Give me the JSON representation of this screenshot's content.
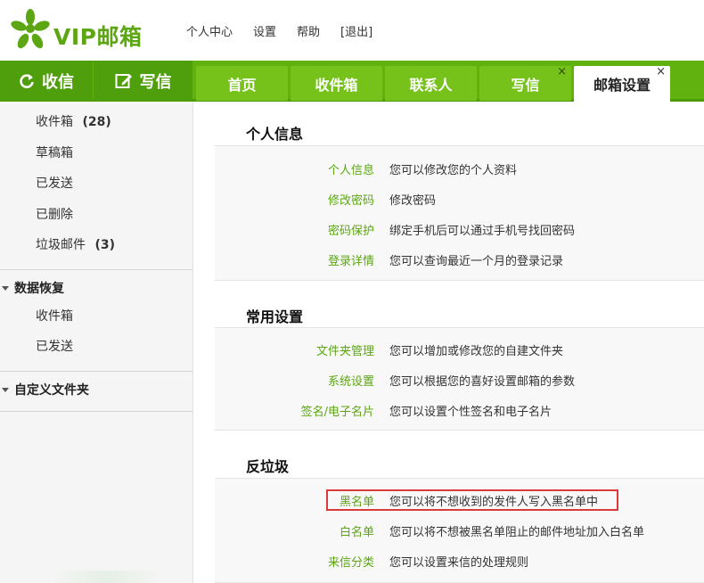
{
  "header": {
    "logo_text": "VIP邮箱",
    "nav": [
      "个人中心",
      "设置",
      "帮助",
      "[退出]"
    ]
  },
  "actions": {
    "receive_label": "收信",
    "write_label": "写信"
  },
  "tabs": [
    {
      "label": "首页"
    },
    {
      "label": "收件箱"
    },
    {
      "label": "联系人"
    },
    {
      "label": "写信",
      "close": "×"
    },
    {
      "label": "邮箱设置",
      "close": "×"
    }
  ],
  "sidebar": {
    "folders": [
      {
        "label": "收件箱",
        "count": "(28)"
      },
      {
        "label": "草稿箱"
      },
      {
        "label": "已发送"
      },
      {
        "label": "已删除"
      },
      {
        "label": "垃圾邮件",
        "count": "(3)"
      }
    ],
    "recovery": {
      "title": "数据恢复",
      "items": [
        "收件箱",
        "已发送"
      ]
    },
    "custom_title": "自定义文件夹"
  },
  "sections": [
    {
      "title": "个人信息",
      "rows": [
        {
          "label": "个人信息",
          "desc": "您可以修改您的个人资料"
        },
        {
          "label": "修改密码",
          "desc": "修改密码"
        },
        {
          "label": "密码保护",
          "desc": "绑定手机后可以通过手机号找回密码"
        },
        {
          "label": "登录详情",
          "desc": "您可以查询最近一个月的登录记录"
        }
      ]
    },
    {
      "title": "常用设置",
      "rows": [
        {
          "label": "文件夹管理",
          "desc": "您可以增加或修改您的自建文件夹"
        },
        {
          "label": "系统设置",
          "desc": "您可以根据您的喜好设置邮箱的参数"
        },
        {
          "label": "签名/电子名片",
          "desc": "您可以设置个性签名和电子名片"
        }
      ]
    },
    {
      "title": "反垃圾",
      "rows": [
        {
          "label": "黑名单",
          "desc": "您可以将不想收到的发件人写入黑名单中"
        },
        {
          "label": "白名单",
          "desc": "您可以将不想被黑名单阻止的邮件地址加入白名单"
        },
        {
          "label": "来信分类",
          "desc": "您可以设置来信的处理规则"
        }
      ]
    }
  ],
  "colors": {
    "brand_green": "#62b20f",
    "label_green": "#5ba612",
    "highlight_red": "#d93a3a"
  }
}
